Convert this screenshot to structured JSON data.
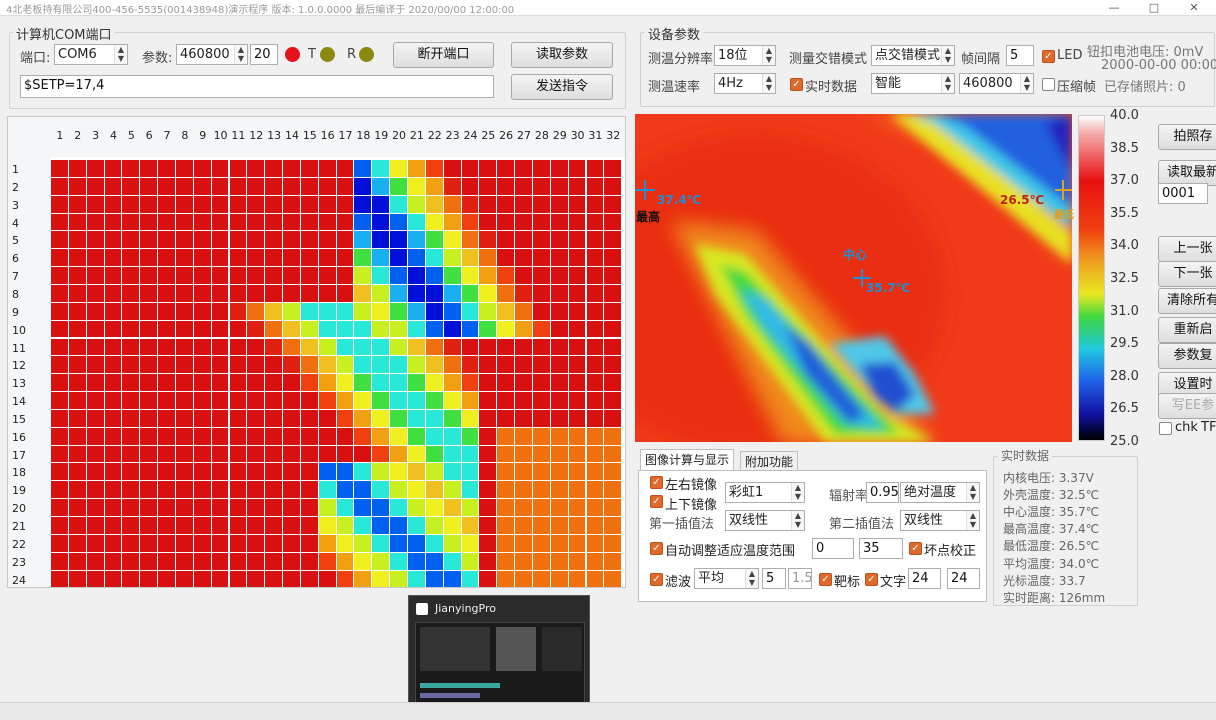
{
  "window": {
    "title": "4北老板持有限公司400-456-5535(001438948)演示程序 版本: 1.0.0.0000 最后编译于 2020/00/00 12:00:00",
    "controls": [
      "—",
      "□",
      "✕"
    ]
  },
  "com_group": {
    "legend": "计算机COM端口",
    "port_label": "端口:",
    "port_value": "COM6",
    "param_label": "参数:",
    "param_value": "460800",
    "param_extra": "20",
    "t_label": "T",
    "r_label": "R",
    "disconnect_btn": "断开端口",
    "read_params_btn": "读取参数",
    "send_cmd_btn": "发送指令",
    "command_value": "$SETP=17,4",
    "t_color": "#e8101a",
    "r_color": "#8a8a10"
  },
  "device_group": {
    "legend": "设备参数",
    "resolution_label": "测温分辨率",
    "resolution_value": "18位",
    "mode_label": "测量交错模式",
    "mode_value": "点交错模式",
    "frame_interval_label": "帧间隔",
    "frame_interval_value": "5",
    "led_label": "LED",
    "battery_label": "钮扣电池电压: 0mV",
    "datetime_text": "2000-00-00 00:00:00",
    "speed_label": "测温速率",
    "speed_value": "4Hz",
    "realtime_label": "实时数据",
    "smart_value": "智能",
    "baud_value": "460800",
    "compress_label": "压缩帧",
    "stored_photos": "已存储照片: 0"
  },
  "grid": {
    "col_headers": [
      "1",
      "2",
      "3",
      "4",
      "5",
      "6",
      "7",
      "8",
      "9",
      "10",
      "11",
      "12",
      "13",
      "14",
      "15",
      "16",
      "17",
      "18",
      "19",
      "20",
      "21",
      "22",
      "23",
      "24",
      "25",
      "26",
      "27",
      "28",
      "29",
      "30",
      "31",
      "32"
    ],
    "row_headers": [
      "1",
      "2",
      "3",
      "4",
      "5",
      "6",
      "7",
      "8",
      "9",
      "10",
      "11",
      "12",
      "13",
      "14",
      "15",
      "16",
      "17",
      "18",
      "19",
      "20",
      "21",
      "22",
      "23",
      "24"
    ]
  },
  "thermal": {
    "max_marker_text": "37.4℃",
    "max_label": "最高",
    "min_marker_text": "26.5℃",
    "min_label": "最低",
    "center_label": "中心",
    "center_marker_text": "35.7℃",
    "marker_color": "#1e8fd8",
    "min_marker_color": "#e0a020"
  },
  "scale": {
    "ticks": [
      "40.0",
      "38.5",
      "37.0",
      "35.5",
      "34.0",
      "32.5",
      "31.0",
      "29.5",
      "28.0",
      "26.5",
      "25.0"
    ]
  },
  "right_buttons": {
    "capture_save": "拍照存",
    "read_latest": "读取最新",
    "index_value": "0001",
    "prev": "上一张",
    "next": "下一张",
    "clear_all": "清除所有",
    "restart": "重新启",
    "params_reset": "参数复",
    "set_time": "设置时",
    "write_ee": "写EE参",
    "chk_label": "chk",
    "tf_label": "TF"
  },
  "tabs": {
    "tab1": "图像计算与显示",
    "tab2": "附加功能",
    "mirror_lr": "左右镜像",
    "mirror_ud": "上下镜像",
    "palette_value": "彩虹1",
    "emissivity_label": "辐射率",
    "emissivity_value": "0.95",
    "temp_mode_value": "绝对温度",
    "interp1_label": "第一插值法",
    "interp1_value": "双线性",
    "interp2_label": "第二插值法",
    "interp2_value": "双线性",
    "auto_range_label": "自动调整适应温度范围",
    "range_min": "0",
    "range_max": "35",
    "bad_pixel_label": "坏点校正",
    "filter_label": "滤波",
    "filter_value": "平均",
    "filter_n": "5",
    "filter_k": "1.5",
    "target_label": "靶标",
    "text_label": "文字",
    "text_size1": "24",
    "text_size2": "24"
  },
  "realtime": {
    "legend": "实时数据",
    "lines": [
      "内核电压: 3.37V",
      "外壳温度: 32.5℃",
      "中心温度: 35.7℃",
      "最高温度: 37.4℃",
      "最低温度: 26.5℃",
      "平均温度: 34.0℃",
      "光标温度: 33.7",
      "实时距离: 126mm"
    ]
  },
  "taskbar_popup": {
    "app_name": "JianyingPro"
  }
}
